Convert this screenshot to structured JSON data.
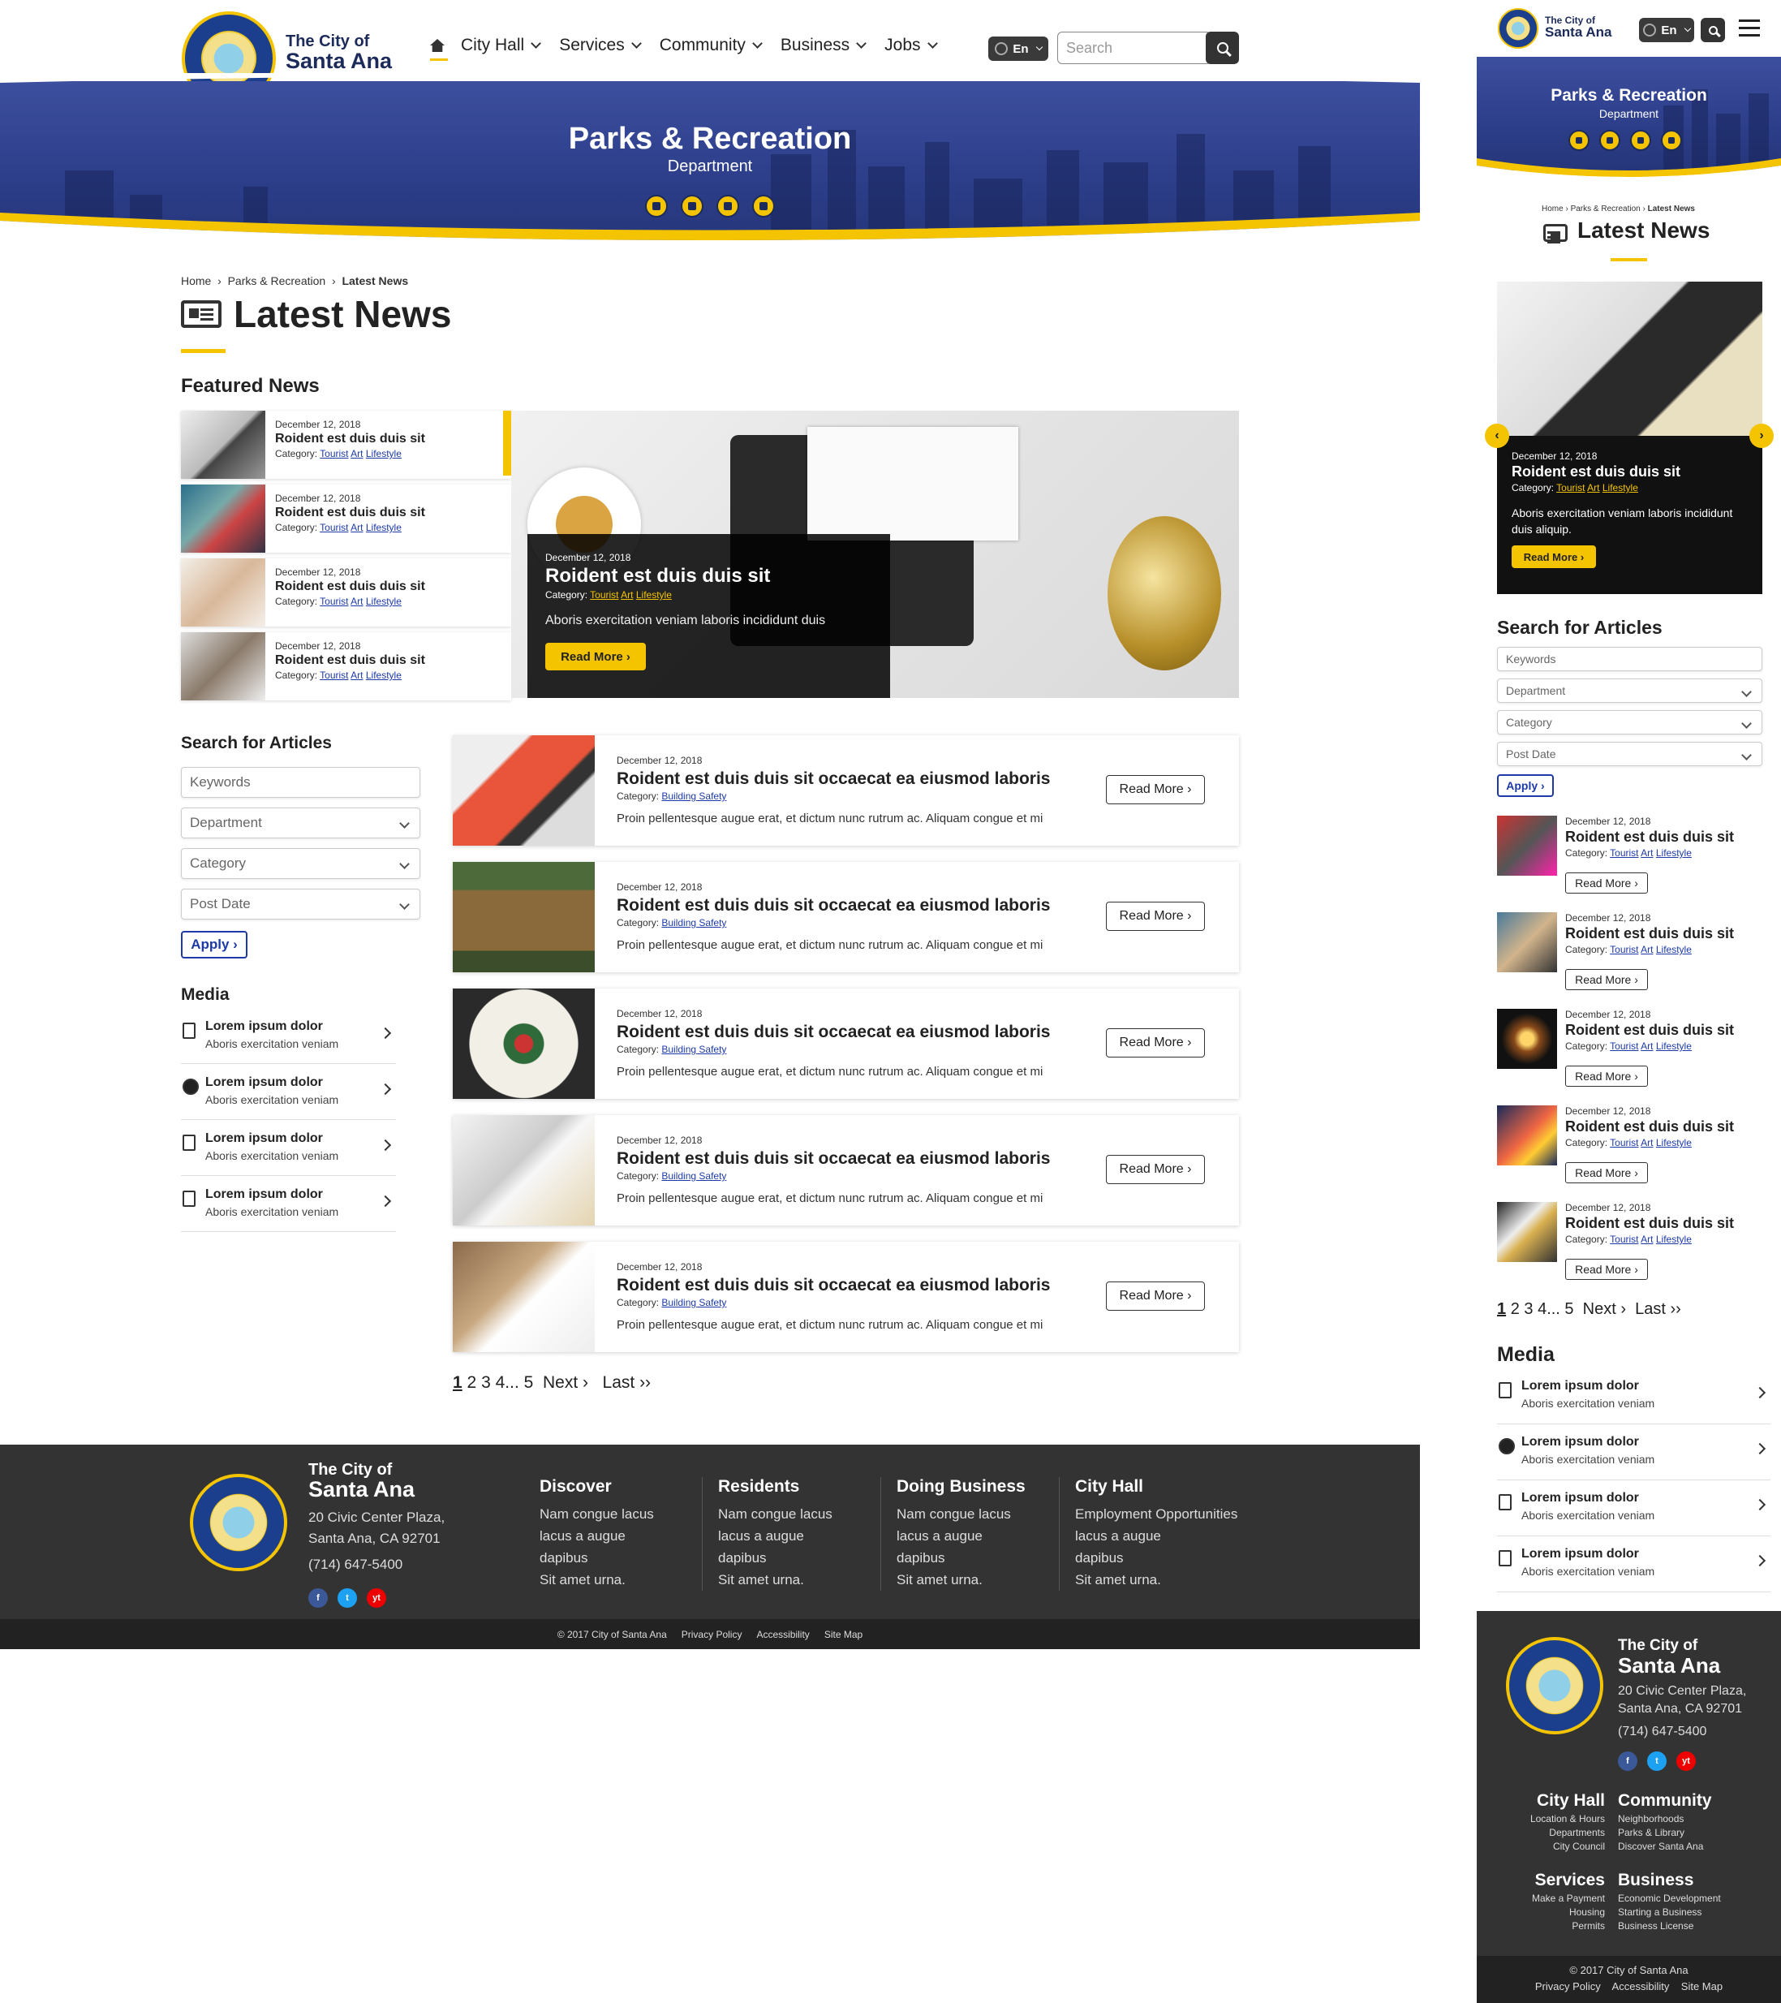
{
  "header": {
    "brand_line1": "The City of",
    "brand_line2": "Santa Ana",
    "nav": [
      {
        "label": "City Hall"
      },
      {
        "label": "Services"
      },
      {
        "label": "Community"
      },
      {
        "label": "Business"
      },
      {
        "label": "Jobs"
      }
    ],
    "lang": "En",
    "search_placeholder": "Search"
  },
  "hero": {
    "title": "Parks & Recreation",
    "subtitle": "Department"
  },
  "breadcrumb": {
    "home": "Home",
    "section": "Parks & Recreation",
    "current": "Latest News"
  },
  "page_title": "Latest News",
  "featured_heading": "Featured News",
  "featured": [
    {
      "date": "December 12, 2018",
      "title": "Roident est duis duis sit",
      "cat_label": "Category:",
      "cats": [
        "Tourist",
        "Art",
        "Lifestyle"
      ]
    },
    {
      "date": "December 12, 2018",
      "title": "Roident est duis duis sit",
      "cat_label": "Category:",
      "cats": [
        "Tourist",
        "Art",
        "Lifestyle"
      ]
    },
    {
      "date": "December 12, 2018",
      "title": "Roident est duis duis sit",
      "cat_label": "Category:",
      "cats": [
        "Tourist",
        "Art",
        "Lifestyle"
      ]
    },
    {
      "date": "December 12, 2018",
      "title": "Roident est duis duis sit",
      "cat_label": "Category:",
      "cats": [
        "Tourist",
        "Art",
        "Lifestyle"
      ]
    }
  ],
  "featured_main": {
    "date": "December 12, 2018",
    "title": "Roident est duis duis sit",
    "cat_label": "Category:",
    "cats": [
      "Tourist",
      "Art",
      "Lifestyle"
    ],
    "excerpt": "Aboris exercitation veniam laboris incididunt duis",
    "button": "Read More"
  },
  "search_articles": {
    "heading": "Search for Articles",
    "keywords_placeholder": "Keywords",
    "department": "Department",
    "category": "Category",
    "post_date": "Post Date",
    "apply": "Apply"
  },
  "media": {
    "heading": "Media",
    "items": [
      {
        "title": "Lorem ipsum dolor",
        "sub": "Aboris exercitation veniam",
        "icon": "document-icon"
      },
      {
        "title": "Lorem ipsum dolor",
        "sub": "Aboris exercitation veniam",
        "icon": "play-icon"
      },
      {
        "title": "Lorem ipsum dolor",
        "sub": "Aboris exercitation veniam",
        "icon": "document-icon"
      },
      {
        "title": "Lorem ipsum dolor",
        "sub": "Aboris exercitation veniam",
        "icon": "document-icon"
      }
    ]
  },
  "articles": [
    {
      "date": "December 12, 2018",
      "title": "Roident est duis duis sit occaecat ea eiusmod laboris",
      "cat_label": "Category:",
      "cat": "Building Safety",
      "excerpt": "Proin pellentesque augue erat, et dictum nunc rutrum ac. Aliquam congue et mi",
      "button": "Read More"
    },
    {
      "date": "December 12, 2018",
      "title": "Roident est duis duis sit occaecat ea eiusmod laboris",
      "cat_label": "Category:",
      "cat": "Building Safety",
      "excerpt": "Proin pellentesque augue erat, et dictum nunc rutrum ac. Aliquam congue et mi",
      "button": "Read More"
    },
    {
      "date": "December 12, 2018",
      "title": "Roident est duis duis sit occaecat ea eiusmod laboris",
      "cat_label": "Category:",
      "cat": "Building Safety",
      "excerpt": "Proin pellentesque augue erat, et dictum nunc rutrum ac. Aliquam congue et mi",
      "button": "Read More"
    },
    {
      "date": "December 12, 2018",
      "title": "Roident est duis duis sit occaecat ea eiusmod laboris",
      "cat_label": "Category:",
      "cat": "Building Safety",
      "excerpt": "Proin pellentesque augue erat, et dictum nunc rutrum ac. Aliquam congue et mi",
      "button": "Read More"
    },
    {
      "date": "December 12, 2018",
      "title": "Roident est duis duis sit occaecat ea eiusmod laboris",
      "cat_label": "Category:",
      "cat": "Building Safety",
      "excerpt": "Proin pellentesque augue erat, et dictum nunc rutrum ac. Aliquam congue et mi",
      "button": "Read More"
    }
  ],
  "pager": {
    "pages": [
      "1",
      "2",
      "3",
      "4",
      "...",
      "5"
    ],
    "next": "Next",
    "last": "Last"
  },
  "footer": {
    "brand_line1": "The City of",
    "brand_line2": "Santa Ana",
    "addr1": "20 Civic Center Plaza,",
    "addr2": "Santa Ana, CA 92701",
    "phone": "(714) 647-5400",
    "social": [
      "f",
      "t",
      "yt"
    ],
    "cols": [
      {
        "title": "Discover",
        "links": [
          "Nam congue lacus",
          "lacus a augue",
          "dapibus",
          "Sit amet urna."
        ]
      },
      {
        "title": "Residents",
        "links": [
          "Nam congue lacus",
          "lacus a augue",
          "dapibus",
          "Sit amet urna."
        ]
      },
      {
        "title": "Doing Business",
        "links": [
          "Nam congue lacus",
          "lacus a augue",
          "dapibus",
          "Sit amet urna."
        ]
      },
      {
        "title": "City Hall",
        "links": [
          "Employment Opportunities",
          "lacus a augue",
          "dapibus",
          "Sit amet urna."
        ]
      }
    ],
    "copyright": "© 2017 City of Santa Ana",
    "legal": [
      "Privacy Policy",
      "Accessibility",
      "Site Map"
    ]
  },
  "mobile": {
    "featured": {
      "date": "December 12, 2018",
      "title": "Roident est duis duis sit",
      "cat_label": "Category:",
      "cats": [
        "Tourist",
        "Art",
        "Lifestyle"
      ],
      "excerpt": "Aboris exercitation veniam laboris incididunt duis aliquip.",
      "button": "Read More"
    },
    "articles": [
      {
        "date": "December 12, 2018",
        "title": "Roident est duis duis sit",
        "cat_label": "Category:",
        "cats": [
          "Tourist",
          "Art",
          "Lifestyle"
        ],
        "button": "Read More"
      },
      {
        "date": "December 12, 2018",
        "title": "Roident est duis duis sit",
        "cat_label": "Category:",
        "cats": [
          "Tourist",
          "Art",
          "Lifestyle"
        ],
        "button": "Read More"
      },
      {
        "date": "December 12, 2018",
        "title": "Roident est duis duis sit",
        "cat_label": "Category:",
        "cats": [
          "Tourist",
          "Art",
          "Lifestyle"
        ],
        "button": "Read More"
      },
      {
        "date": "December 12, 2018",
        "title": "Roident est duis duis sit",
        "cat_label": "Category:",
        "cats": [
          "Tourist",
          "Art",
          "Lifestyle"
        ],
        "button": "Read More"
      },
      {
        "date": "December 12, 2018",
        "title": "Roident est duis duis sit",
        "cat_label": "Category:",
        "cats": [
          "Tourist",
          "Art",
          "Lifestyle"
        ],
        "button": "Read More"
      }
    ],
    "footer_cols": [
      {
        "title": "City Hall",
        "links": [
          "Location & Hours",
          "Departments",
          "City Council"
        ]
      },
      {
        "title": "Community",
        "links": [
          "Neighborhoods",
          "Parks & Library",
          "Discover Santa Ana"
        ]
      },
      {
        "title": "Services",
        "links": [
          "Make a Payment",
          "Housing",
          "Permits"
        ]
      },
      {
        "title": "Business",
        "links": [
          "Economic Development",
          "Starting a Business",
          "Business License"
        ]
      }
    ]
  },
  "colors": {
    "accent": "#f4c400",
    "navy": "#2e3f8c",
    "footer": "#333333",
    "link": "#1d3aa8"
  }
}
